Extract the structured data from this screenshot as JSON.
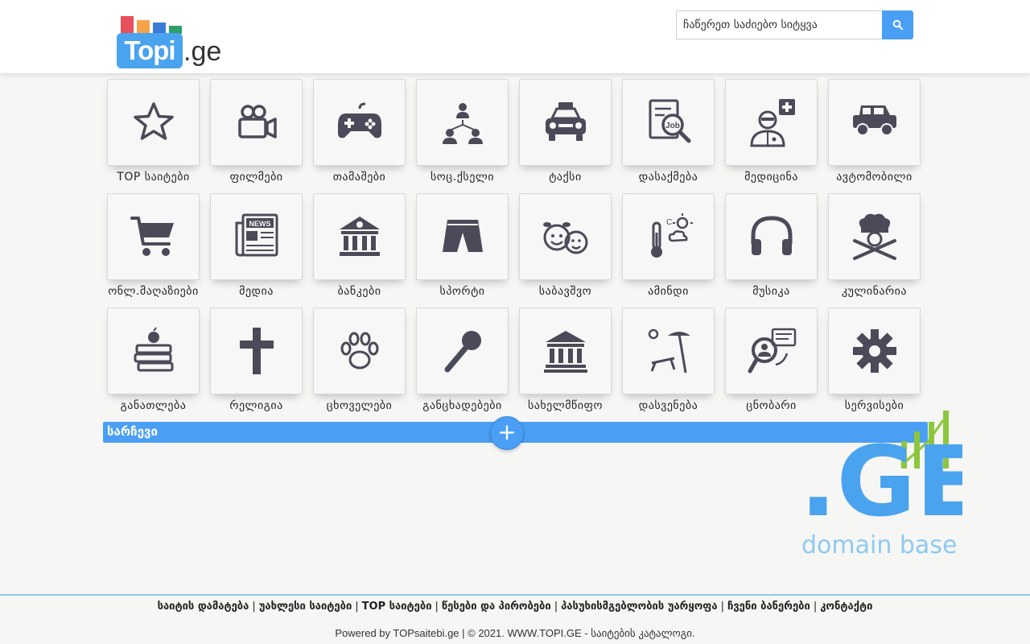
{
  "site": {
    "logo_main": "Topi",
    "logo_suffix": ".ge"
  },
  "search": {
    "placeholder": "ჩაწერეთ საძიებო სიტყვა",
    "button_icon": "search-icon"
  },
  "categories": [
    {
      "label": "TOP საიტები",
      "icon": "star-icon"
    },
    {
      "label": "ფილმები",
      "icon": "video-camera-icon"
    },
    {
      "label": "თამაშები",
      "icon": "gamepad-icon"
    },
    {
      "label": "სოც.ქსელი",
      "icon": "social-network-icon"
    },
    {
      "label": "ტაქსი",
      "icon": "taxi-icon"
    },
    {
      "label": "დასაქმება",
      "icon": "job-search-icon"
    },
    {
      "label": "მედიცინა",
      "icon": "doctor-icon"
    },
    {
      "label": "ავტომობილი",
      "icon": "car-icon"
    },
    {
      "label": "ონლ.მაღაზიები",
      "icon": "shopping-cart-icon"
    },
    {
      "label": "მედია",
      "icon": "newspaper-icon"
    },
    {
      "label": "ბანკები",
      "icon": "bank-icon"
    },
    {
      "label": "სპორტი",
      "icon": "shorts-icon"
    },
    {
      "label": "საბავშვო",
      "icon": "kids-icon"
    },
    {
      "label": "ამინდი",
      "icon": "weather-icon"
    },
    {
      "label": "მუსიკა",
      "icon": "headphones-icon"
    },
    {
      "label": "კულინარია",
      "icon": "chef-icon"
    },
    {
      "label": "განათლება",
      "icon": "books-apple-icon"
    },
    {
      "label": "რელიგია",
      "icon": "cross-icon"
    },
    {
      "label": "ცხოველები",
      "icon": "paw-icon"
    },
    {
      "label": "განცხადებები",
      "icon": "microphone-icon"
    },
    {
      "label": "სახელმწიფო",
      "icon": "government-building-icon"
    },
    {
      "label": "დასვენება",
      "icon": "beach-icon"
    },
    {
      "label": "ცნობარი",
      "icon": "info-search-icon"
    },
    {
      "label": "სერვისები",
      "icon": "gear-icon"
    }
  ],
  "section": {
    "title": "სარჩევი",
    "toggle": "+"
  },
  "banner": {
    "big": ".GE",
    "sub": "domain base"
  },
  "footer": {
    "links": [
      "საიტის დამატება",
      "უახლესი საიტები",
      "TOP საიტები",
      "წესები და პირობები",
      "პასუხისმგებლობის უარყოფა",
      "ჩვენი ბანერები",
      "კონტაქტი"
    ],
    "separator": "|",
    "powered": "Powered by TOPsaitebi.ge | © 2021. WWW.TOPI.GE - საიტების კატალოგი."
  },
  "colors": {
    "accent": "#4a9ff5",
    "icon": "#4a4a58",
    "logo_blue": "#4aa3ee"
  }
}
